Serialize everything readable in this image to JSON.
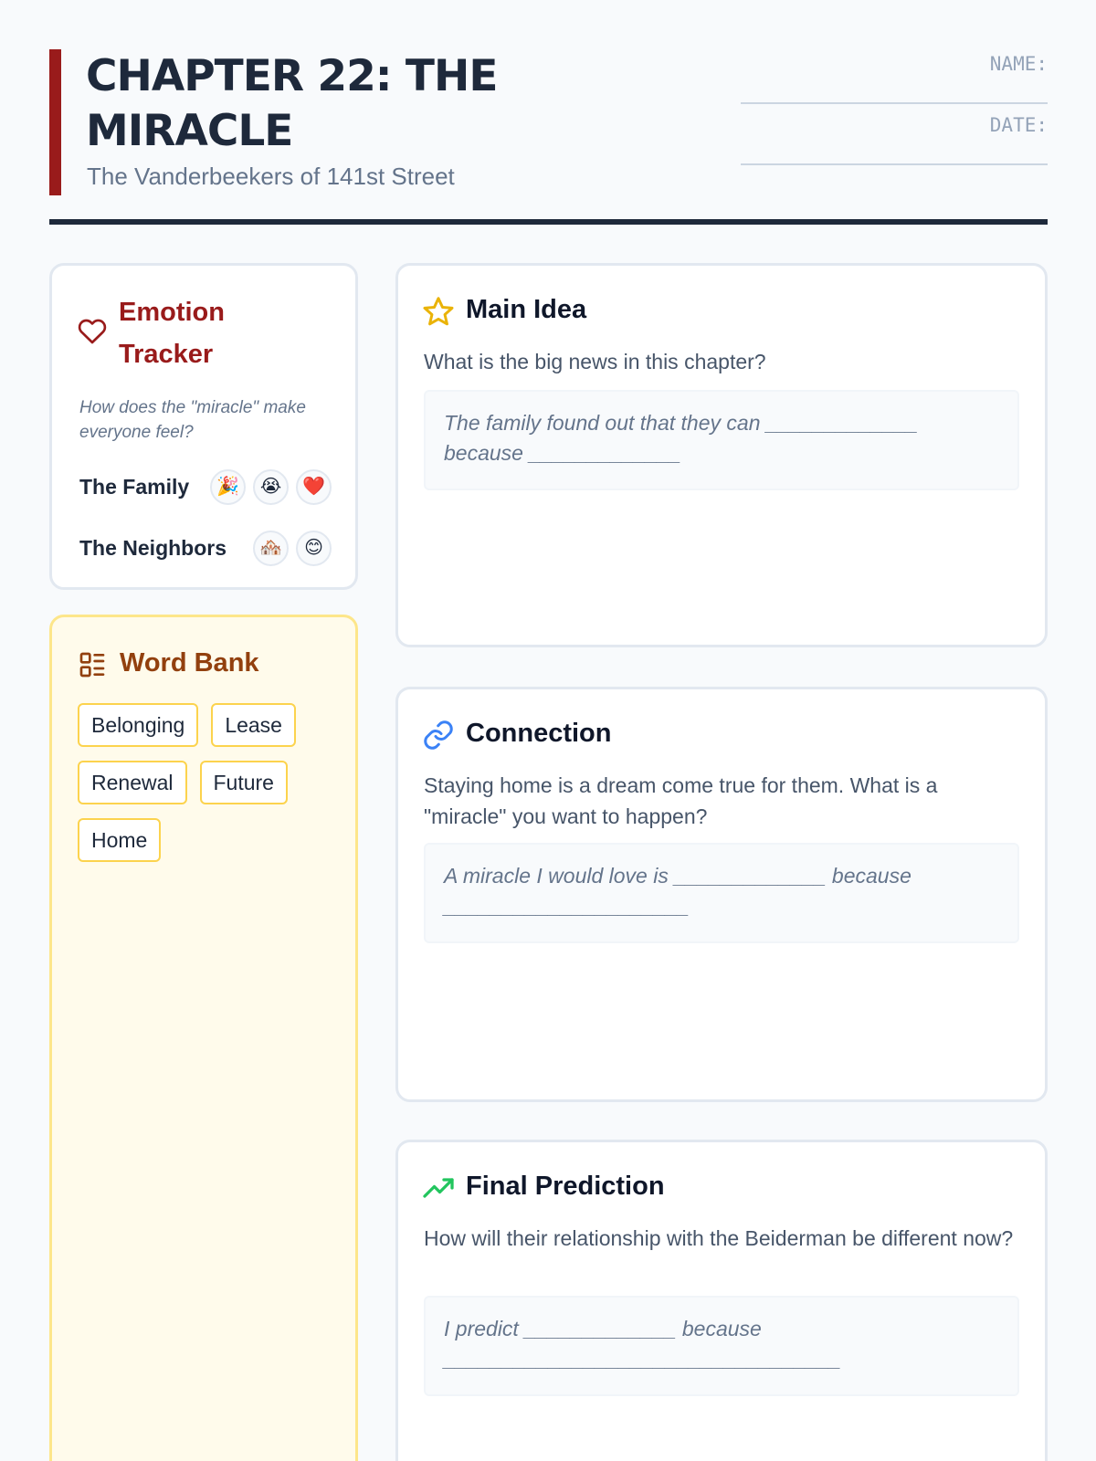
{
  "header": {
    "title": "Chapter 22: The Miracle",
    "subtitle": "The Vanderbeekers of 141st Street",
    "name_label": "NAME:",
    "date_label": "DATE:"
  },
  "emotion_tracker": {
    "title": "Emotion Tracker",
    "icon": "heart-icon",
    "prompt": "How does the \"miracle\" make everyone feel?",
    "rows": [
      {
        "label": "The Family",
        "emojis": [
          "🎉",
          "😭",
          "❤️"
        ]
      },
      {
        "label": "The Neighbors",
        "emojis": [
          "🏘️",
          "😊"
        ]
      }
    ]
  },
  "word_bank": {
    "title": "Word Bank",
    "icon": "list-icon",
    "words": [
      "Belonging",
      "Lease",
      "Renewal",
      "Future",
      "Home"
    ]
  },
  "main_idea": {
    "title": "Main Idea",
    "icon": "star-icon",
    "question": "What is the big news in this chapter?",
    "answer": "The family found out that they can _____________ because _____________"
  },
  "connection": {
    "title": "Connection",
    "icon": "link-icon",
    "question": "Staying home is a dream come true for them. What is a \"miracle\" you want to happen?",
    "answer": "A miracle I would love is _____________ because _____________________"
  },
  "final_prediction": {
    "title": "Final Prediction",
    "icon": "trending-up-icon",
    "question": "How will their relationship with the Beiderman be different now?",
    "answer": "I predict _____________ because __________________________________"
  },
  "colors": {
    "accent": "#991b1b",
    "word_bank_bg": "#fffbeb",
    "word_bank_border": "#fde68a",
    "star": "#eab308",
    "link": "#3b82f6",
    "trend": "#22c55e"
  }
}
